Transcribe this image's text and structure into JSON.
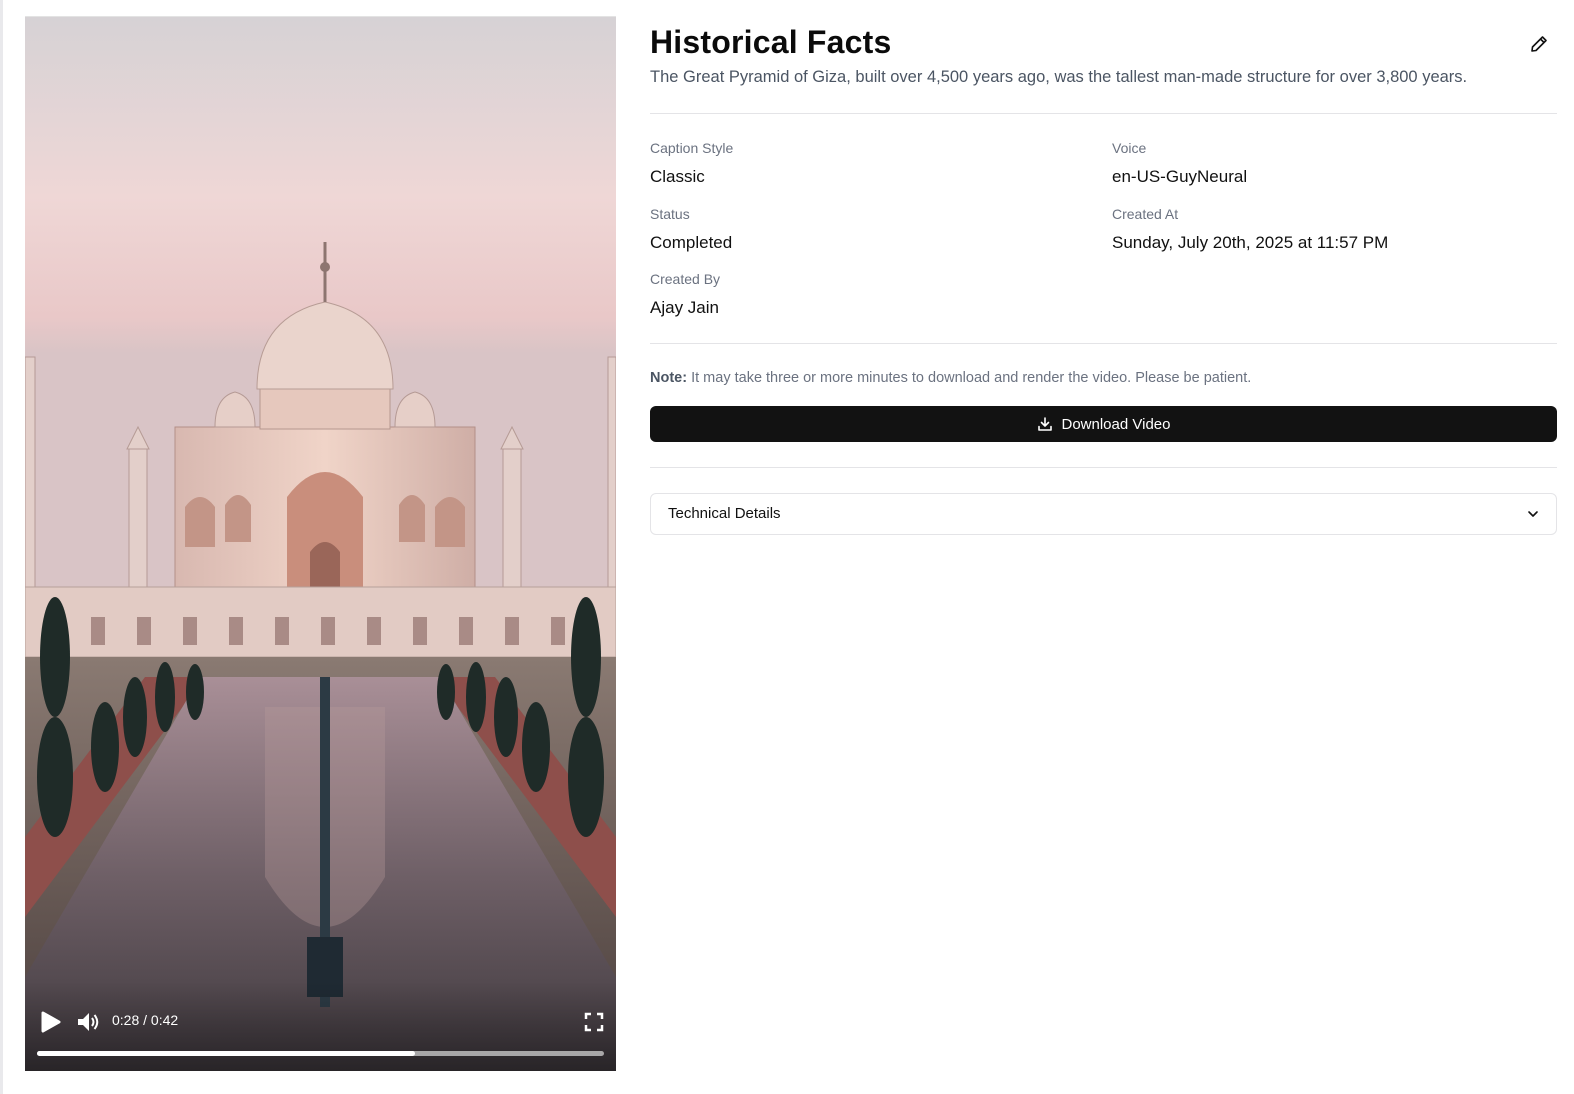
{
  "video": {
    "current_time": "0:28",
    "duration": "0:42",
    "time_display": "0:28 / 0:42",
    "progress_fraction": 0.6667,
    "scene": "taj-mahal-reflecting-pool"
  },
  "details": {
    "title": "Historical Facts",
    "description": "The Great Pyramid of Giza, built over 4,500 years ago, was the tallest man-made structure for over 3,800 years.",
    "fields": {
      "caption_style": {
        "label": "Caption Style",
        "value": "Classic"
      },
      "voice": {
        "label": "Voice",
        "value": "en-US-GuyNeural"
      },
      "status": {
        "label": "Status",
        "value": "Completed"
      },
      "created_at": {
        "label": "Created At",
        "value": "Sunday, July 20th, 2025 at 11:57 PM"
      },
      "created_by": {
        "label": "Created By",
        "value": "Ajay Jain"
      }
    },
    "note_label": "Note:",
    "note_text": " It may take three or more minutes to download and render the video. Please be patient.",
    "download_label": "Download Video",
    "technical_details_label": "Technical Details"
  },
  "icons": {
    "play": "play-icon",
    "volume": "volume-icon",
    "fullscreen": "fullscreen-icon",
    "edit": "pencil-icon",
    "download": "download-icon",
    "chevron": "chevron-down-icon"
  },
  "colors": {
    "primary_button": "#121212",
    "muted_text": "#6b7280",
    "divider": "#e4e4e7"
  }
}
